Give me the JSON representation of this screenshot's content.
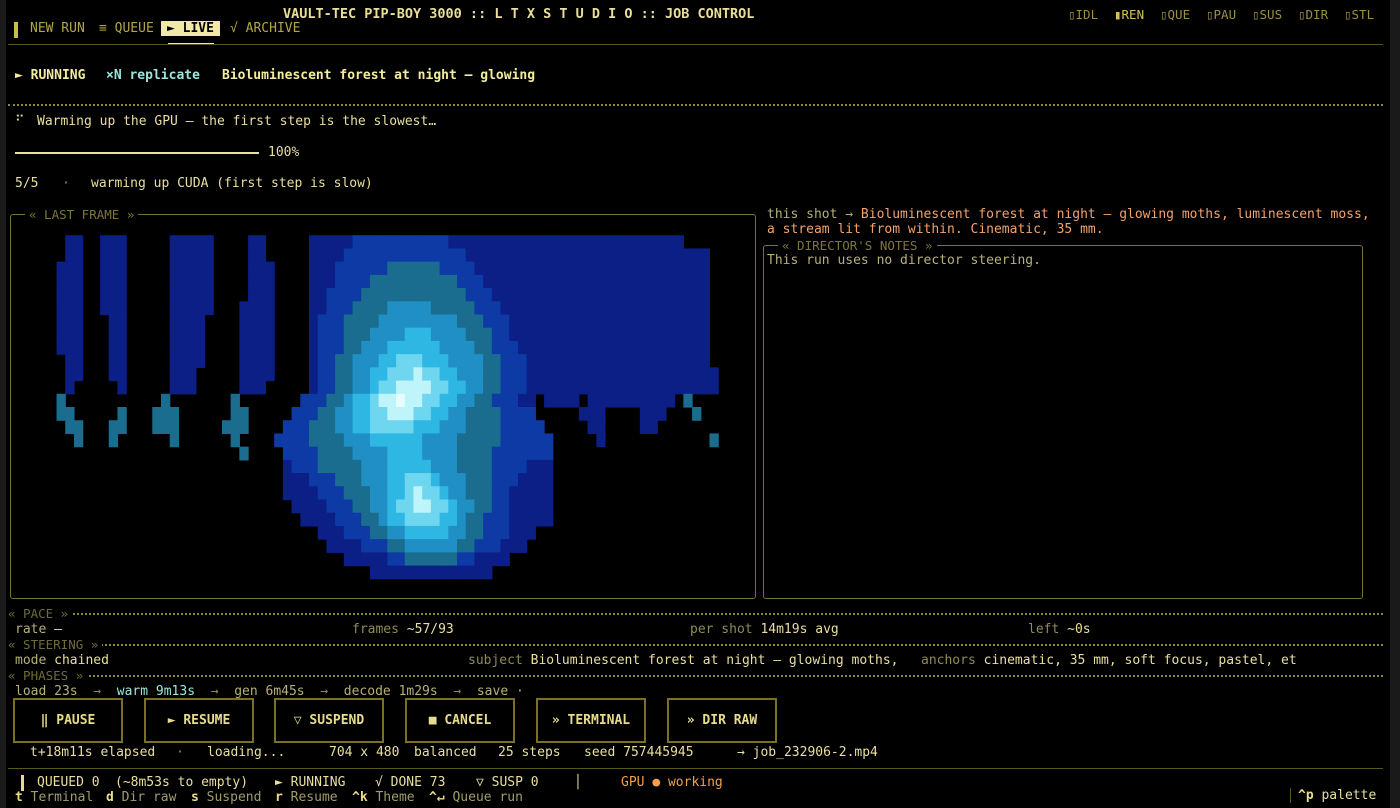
{
  "header": {
    "title": "VAULT-TEC  PIP-BOY 3000  ::  L T X   S T U D I O  ::  JOB CONTROL",
    "tabs": [
      {
        "label": "NEW RUN",
        "active": false
      },
      {
        "label": "≡ QUEUE",
        "active": false
      },
      {
        "label": "► LIVE",
        "active": true
      },
      {
        "label": "√ ARCHIVE",
        "active": false
      }
    ],
    "states": [
      "▯IDL",
      "▮REN",
      "▯QUE",
      "▯PAU",
      "▯SUS",
      "▯DIR",
      "▯STL"
    ]
  },
  "run": {
    "status": "► RUNNING",
    "mode": "×N replicate",
    "prompt_short": "Bioluminescent forest at night — glowing"
  },
  "progress": {
    "spinner": "⠋",
    "message": "Warming up the GPU — the first step is the slowest…",
    "percent_label": "100%",
    "percent": 1.0,
    "step": "5/5",
    "separator": "·",
    "step_message": "warming up CUDA (first step is slow)"
  },
  "last_frame": {
    "title": "« LAST FRAME »",
    "pixel_rows": [
      ".....................................................................................",
      "......11..111.....11111....11.....1111122222222222111111111111111111111111111........",
      "......11..111.....11111....11.....1111222222222222221111111111111111111111111111.....",
      ".....111..111.....11111....111....1112222223333332222111111111111111111111111111.....",
      ".....111..111.....11111....111....1112222333333333322211111111111111111111111111.....",
      ".....111..111.....11111....111....1122223333333333332221111111111111111111111111.....",
      ".....111..111.....11111...1111....1122233334444433333222111111111111111111111111.....",
      ".....111...11.....1111....1111....1222333344444444433322211111111111111111111111.....",
      ".....111...11.....1111....1111....1222333444455544443332211111111111111111111111.....",
      ".....111...11.....1111....1111....1222334445555554444332221111111111111111111111.....",
      "......11...11.....1111....1111....1223344455666555444433222111111111111111111111.....",
      "......11...11.....111.....1111....12233445566676655444332221111111111111111111111....",
      "......1.....1.....111.....111.....12233445667777665544332221111111111111111111111....",
      ".....3...........3.......3.......222334556778776655443322211.1111.1111111111.3.......",
      ".....33.....3...333......33.....2223344556677766554433332222.....111....111...3......",
      "......33...33...333.....333....222333445566666555444333322222.....11....11...........",
      ".......3...3......3......3....22223333444555555444433333222222.....1............3....",
      "..........................3....2222333344445555444433332222222.......................",
      "...............................1222333334445555544433332222111.......................",
      "...............................1112223334445566654443332221111.......................",
      "...............................1111222333445567665443332211111.......................",
      "................................111122233445667766544332211111.......................",
      ".................................11112223345566665543322211111.......................",
      "...................................1112223344555554433222111.........................",
      "....................................11112223344444433222111..........................",
      "......................................1111122333333221111............................",
      ".........................................11111111111111..............................",
      "....................................................................................."
    ],
    "palette": {
      ".": "#000000",
      "1": "#0b1f86",
      "2": "#0e3aa6",
      "3": "#1a6d8f",
      "4": "#1f8fc4",
      "5": "#2fb7e3",
      "6": "#6fd6f0",
      "7": "#bff4fb",
      "8": "#e6fdff"
    }
  },
  "shot": {
    "label": "this shot →",
    "text": "Bioluminescent forest at night — glowing moths, luminescent moss,",
    "text2": "a stream lit from within. Cinematic, 35 mm."
  },
  "director_notes": {
    "title": "« DIRECTOR'S NOTES »",
    "text": "This run uses no director steering."
  },
  "pace": {
    "section": "« PACE »",
    "rate_label": "rate",
    "rate_value": "—",
    "frames_label": "frames",
    "frames_value": "~57/93",
    "per_shot_label": "per shot",
    "per_shot_value": "14m19s avg",
    "left_label": "left",
    "left_value": "~0s"
  },
  "steering": {
    "section": "« STEERING »",
    "mode_label": "mode",
    "mode_value": "chained",
    "subject_label": "subject",
    "subject_value": "Bioluminescent forest at night — glowing moths,",
    "anchors_label": "anchors",
    "anchors_value": "cinematic, 35 mm, soft focus, pastel, et"
  },
  "phases": {
    "section": "« PHASES »",
    "load": "load 23s",
    "arrow": "→",
    "warm": "warm 9m13s",
    "gen": "gen 6m45s",
    "decode": "decode 1m29s",
    "save": "save ·"
  },
  "buttons": {
    "pause": "‖ PAUSE",
    "resume": "► RESUME",
    "suspend": "▽ SUSPEND",
    "cancel": "■ CANCEL",
    "terminal": "» TERMINAL",
    "dir_raw": "» DIR RAW"
  },
  "job_info": {
    "elapsed": "t+18m11s elapsed",
    "separator": "·",
    "state": "loading...",
    "resolution": "704 x 480",
    "preset": "balanced",
    "steps": "25 steps",
    "seed": "seed 757445945",
    "output": "→ job_232906-2.mp4"
  },
  "statusbar": {
    "queued": "QUEUED 0",
    "eta": "(~8m53s to empty)",
    "running": "► RUNNING",
    "done": "√ DONE 73",
    "susp": "▽ SUSP 0",
    "divider": "│",
    "gpu_label": "GPU",
    "gpu_dot": "●",
    "gpu_state": "working",
    "colors": {
      "gpu": "#f2a04d"
    }
  },
  "shortcuts": [
    {
      "key": "t",
      "label": "Terminal"
    },
    {
      "key": "d",
      "label": "Dir raw"
    },
    {
      "key": "s",
      "label": "Suspend"
    },
    {
      "key": "r",
      "label": "Resume"
    },
    {
      "key": "^k",
      "label": "Theme"
    },
    {
      "key": "^↵",
      "label": "Queue run"
    }
  ],
  "palette_hint": {
    "key": "^p",
    "label": "palette"
  }
}
